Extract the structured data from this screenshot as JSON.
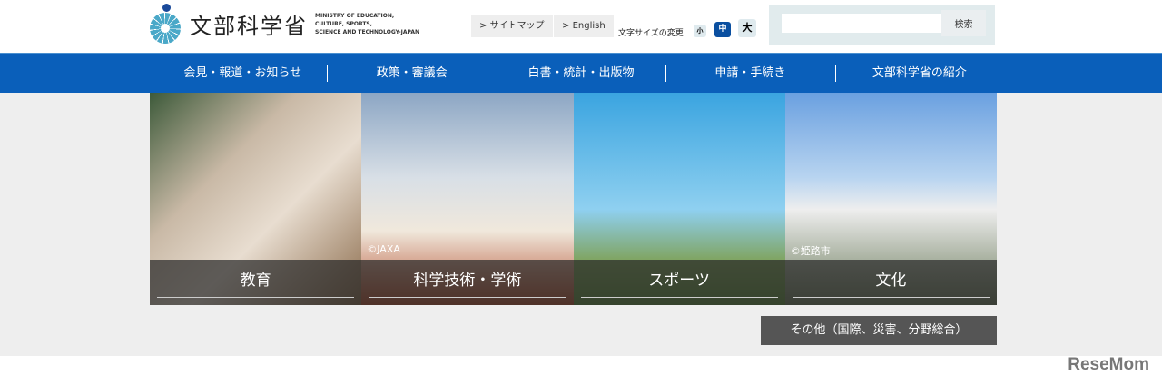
{
  "logo": {
    "jp": "文部科学省",
    "en": [
      "MINISTRY OF EDUCATION,",
      "CULTURE, SPORTS,",
      "SCIENCE AND TECHNOLOGY-JAPAN"
    ]
  },
  "header": {
    "sitemap": "サイトマップ",
    "english": "English",
    "font_size_label": "文字サイズの変更",
    "sizes": [
      "小",
      "中",
      "大"
    ],
    "search_button": "検索",
    "search_placeholder": ""
  },
  "nav": [
    "会見・報道・お知らせ",
    "政策・審議会",
    "白書・統計・出版物",
    "申請・手続き",
    "文部科学省の紹介"
  ],
  "tiles": [
    {
      "label": "教育",
      "credit": ""
    },
    {
      "label": "科学技術・学術",
      "credit": "©JAXA"
    },
    {
      "label": "スポーツ",
      "credit": ""
    },
    {
      "label": "文化",
      "credit": "©姫路市"
    }
  ],
  "other_button": "その他（国際、災害、分野総合）",
  "watermark": "ReseMom"
}
